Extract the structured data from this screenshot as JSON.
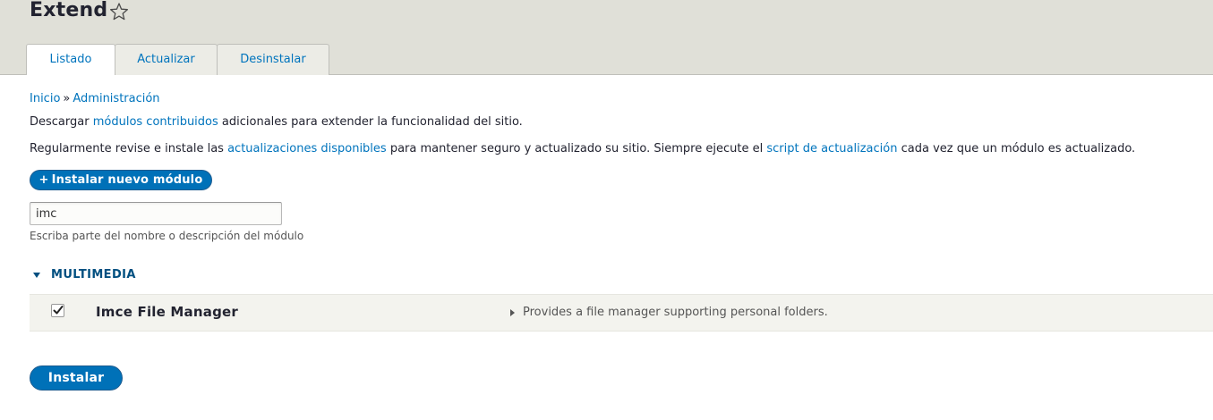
{
  "header": {
    "title": "Extend",
    "tabs": [
      {
        "label": "Listado",
        "active": true
      },
      {
        "label": "Actualizar",
        "active": false
      },
      {
        "label": "Desinstalar",
        "active": false
      }
    ]
  },
  "breadcrumb": {
    "items": [
      "Inicio",
      "Administración"
    ],
    "separator": "»"
  },
  "intro": {
    "line1_before": "Descargar ",
    "line1_link": "módulos contribuidos",
    "line1_after": " adicionales para extender la funcionalidad del sitio.",
    "line2_before": "Regularmente revise e instale las ",
    "line2_link1": "actualizaciones disponibles",
    "line2_middle": " para mantener seguro y actualizado su sitio. Siempre ejecute el ",
    "line2_link2": "script de actualización",
    "line2_after": " cada vez que un módulo es actualizado."
  },
  "install_new_button": {
    "plus": "+",
    "label": "Instalar nuevo módulo"
  },
  "filter": {
    "value": "imc",
    "description": "Escriba parte del nombre o descripción del módulo"
  },
  "group": {
    "label": "MULTIMEDIA",
    "modules": [
      {
        "name": "Imce File Manager",
        "checked": true,
        "description": "Provides a file manager supporting personal folders."
      }
    ]
  },
  "submit_button": {
    "label": "Instalar"
  },
  "colors": {
    "accent": "#0071b8",
    "link": "#0074bd",
    "header_bg": "#e0e0d8",
    "group_label": "#004f80",
    "row_bg": "#f3f3ee"
  }
}
